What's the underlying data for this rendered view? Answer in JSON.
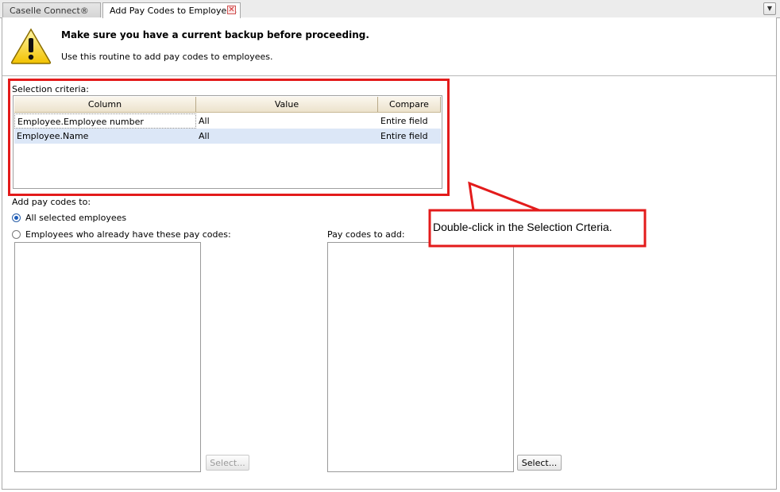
{
  "tabs": [
    {
      "label": "Caselle Connect®"
    },
    {
      "label": "Add Pay Codes to Employees"
    }
  ],
  "header": {
    "title": "Make sure you have a current backup before proceeding.",
    "subtitle": "Use this routine to add pay codes to employees."
  },
  "criteria": {
    "label": "Selection criteria:",
    "columns": [
      "Column",
      "Value",
      "Compare"
    ],
    "rows": [
      {
        "column": "Employee.Employee number",
        "value": "All",
        "compare": "Entire field"
      },
      {
        "column": "Employee.Name",
        "value": "All",
        "compare": "Entire field"
      }
    ]
  },
  "add_to": {
    "label": "Add pay codes to:",
    "option_all": "All selected employees",
    "option_existing": "Employees who already have these pay codes:",
    "selected": "all"
  },
  "pay_codes": {
    "label": "Pay codes to add:"
  },
  "buttons": {
    "select_left": "Select...",
    "select_right": "Select..."
  },
  "callout": {
    "text": "Double-click in the Selection Crteria."
  },
  "colors": {
    "annotation": "#e31b1b",
    "selected_row": "#dce7f7"
  }
}
